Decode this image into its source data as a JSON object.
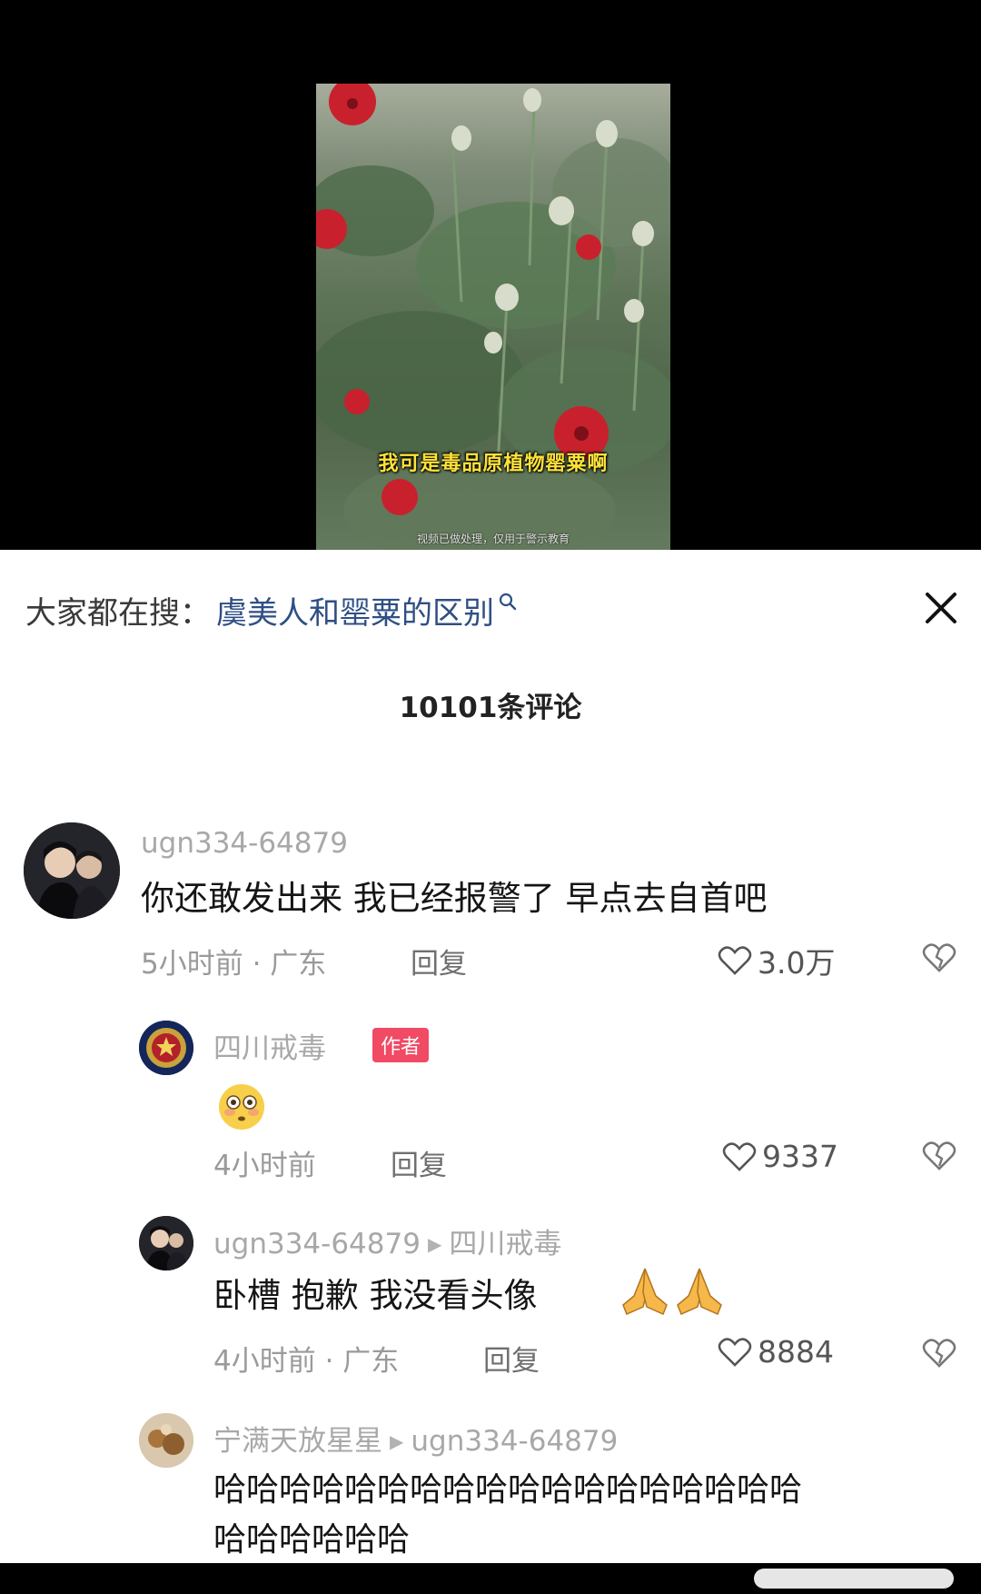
{
  "video": {
    "subtitle": "我可是毒品原植物罂粟啊",
    "watermark": "视频已做处理，仅用于警示教育"
  },
  "search": {
    "prefix": "大家都在搜：",
    "term": "虞美人和罂粟的区别"
  },
  "comments_header": {
    "count_label": "10101条评论"
  },
  "comments": [
    {
      "user": "ugn334-64879",
      "text": "你还敢发出来 我已经报警了 早点去自首吧",
      "meta": "5小时前 · 广东",
      "reply_label": "回复",
      "likes": "3.0万"
    },
    {
      "user": "四川戒毒",
      "badge": "作者",
      "emoji": "flushed-face",
      "meta": "4小时前",
      "reply_label": "回复",
      "likes": "9337"
    },
    {
      "user": "ugn334-64879",
      "reply_to": "四川戒毒",
      "text": "卧槽 抱歉 我没看头像",
      "emoji": "folded-hands",
      "meta": "4小时前 · 广东",
      "reply_label": "回复",
      "likes": "8884"
    },
    {
      "user": "宁满天放星星",
      "reply_to": "ugn334-64879",
      "text_line1": "哈哈哈哈哈哈哈哈哈哈哈哈哈哈哈哈哈哈",
      "text_line2": "哈哈哈哈哈哈"
    }
  ],
  "colors": {
    "search_term": "#2f4f84",
    "author_badge": "#f04a64",
    "subtitle": "#ffe23a"
  }
}
